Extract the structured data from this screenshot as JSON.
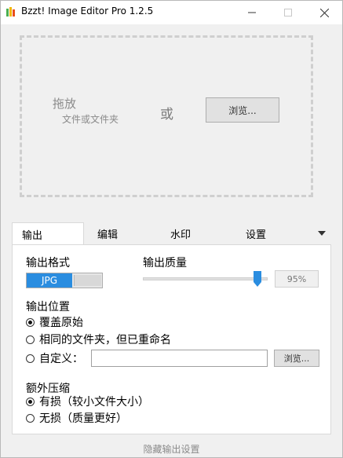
{
  "window": {
    "title": "Bzzt! Image Editor Pro 1.2.5"
  },
  "drop_zone": {
    "main_text": "拖放",
    "sub_text": "文件或文件夹",
    "or_text": "或",
    "browse_label": "浏览..."
  },
  "tabs": [
    {
      "label": "输出",
      "active": true
    },
    {
      "label": "编辑",
      "active": false
    },
    {
      "label": "水印",
      "active": false
    },
    {
      "label": "设置",
      "active": false
    }
  ],
  "output": {
    "format_label": "输出格式",
    "format_value": "JPG",
    "quality_label": "输出质量",
    "quality_value": "95%",
    "quality_fraction": 0.95,
    "location_label": "输出位置",
    "location_options": [
      {
        "label": "覆盖原始",
        "checked": true
      },
      {
        "label": "相同的文件夹，但已重命名",
        "checked": false
      },
      {
        "label": "自定义：",
        "checked": false
      }
    ],
    "custom_path_value": "",
    "custom_browse_label": "浏览...",
    "compress_label": "额外压缩",
    "compress_options": [
      {
        "label": "有损（较小文件大小）",
        "checked": true
      },
      {
        "label": "无损（质量更好）",
        "checked": false
      }
    ]
  },
  "footer": {
    "link_label": "隐藏输出设置"
  },
  "colors": {
    "accent": "#2a8de0",
    "window_bg": "#f0f0f0",
    "panel_bg": "#ffffff"
  }
}
